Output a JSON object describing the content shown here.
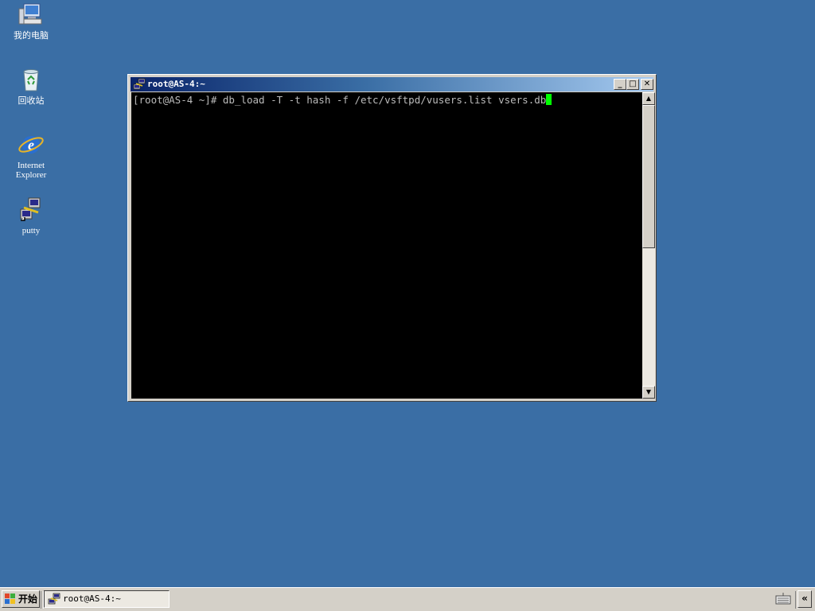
{
  "desktop": {
    "background_color": "#3a6ea5",
    "icons": [
      {
        "label": "我的电脑",
        "icon": "my-computer-icon"
      },
      {
        "label": "回收站",
        "icon": "recycle-bin-icon"
      },
      {
        "label_line1": "Internet",
        "label_line2": "Explorer",
        "icon": "internet-explorer-icon"
      },
      {
        "label": "putty",
        "icon": "putty-icon"
      }
    ]
  },
  "window": {
    "title": "root@AS-4:~",
    "icon": "putty-icon",
    "buttons": {
      "minimize": "_",
      "maximize": "□",
      "close": "✕"
    },
    "terminal": {
      "line1": "[root@AS-4 ~]# db_load -T -t hash -f /etc/vsftpd/vusers.list vsers.db",
      "cursor_color": "#00ff00"
    }
  },
  "taskbar": {
    "start_label": "开始",
    "task_label": "root@AS-4:~",
    "tray_toggle": "«"
  }
}
